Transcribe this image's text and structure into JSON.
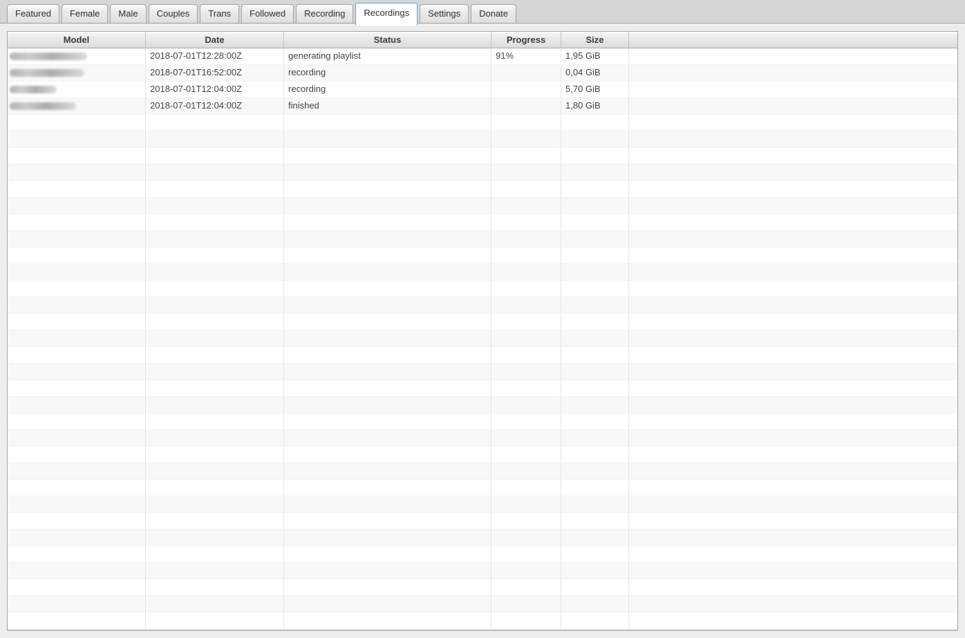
{
  "tabs": {
    "items": [
      {
        "label": "Featured",
        "active": false
      },
      {
        "label": "Female",
        "active": false
      },
      {
        "label": "Male",
        "active": false
      },
      {
        "label": "Couples",
        "active": false
      },
      {
        "label": "Trans",
        "active": false
      },
      {
        "label": "Followed",
        "active": false
      },
      {
        "label": "Recording",
        "active": false
      },
      {
        "label": "Recordings",
        "active": true
      },
      {
        "label": "Settings",
        "active": false
      },
      {
        "label": "Donate",
        "active": false
      }
    ]
  },
  "table": {
    "columns": [
      {
        "label": "Model"
      },
      {
        "label": "Date"
      },
      {
        "label": "Status"
      },
      {
        "label": "Progress"
      },
      {
        "label": "Size"
      },
      {
        "label": ""
      }
    ],
    "rows": [
      {
        "model_redacted": true,
        "model_blur_width": 112,
        "date": "2018-07-01T12:28:00Z",
        "status": "generating playlist",
        "progress": "91%",
        "size": "1,95 GiB"
      },
      {
        "model_redacted": true,
        "model_blur_width": 108,
        "date": "2018-07-01T16:52:00Z",
        "status": "recording",
        "progress": "",
        "size": "0,04 GiB"
      },
      {
        "model_redacted": true,
        "model_blur_width": 68,
        "date": "2018-07-01T12:04:00Z",
        "status": "recording",
        "progress": "",
        "size": "5,70 GiB"
      },
      {
        "model_redacted": true,
        "model_blur_width": 96,
        "date": "2018-07-01T12:04:00Z",
        "status": "finished",
        "progress": "",
        "size": "1,80 GiB"
      }
    ],
    "empty_row_count": 31
  },
  "colors": {
    "active_tab_border": "#58a3d9",
    "page_background": "#ededed",
    "tabbar_background": "#d6d6d6",
    "row_stripe": "#f8f8f8",
    "header_text": "#3b3b3b",
    "cell_text": "#434343"
  }
}
